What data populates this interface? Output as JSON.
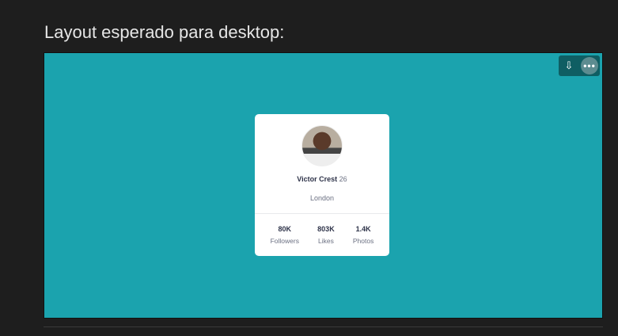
{
  "heading": "Layout esperado para desktop:",
  "toolbar": {
    "download_icon": "⊕",
    "more_label": "•••"
  },
  "card": {
    "name": "Victor Crest",
    "age": "26",
    "city": "London",
    "stats": [
      {
        "value": "80K",
        "label": "Followers"
      },
      {
        "value": "803K",
        "label": "Likes"
      },
      {
        "value": "1.4K",
        "label": "Photos"
      }
    ]
  }
}
